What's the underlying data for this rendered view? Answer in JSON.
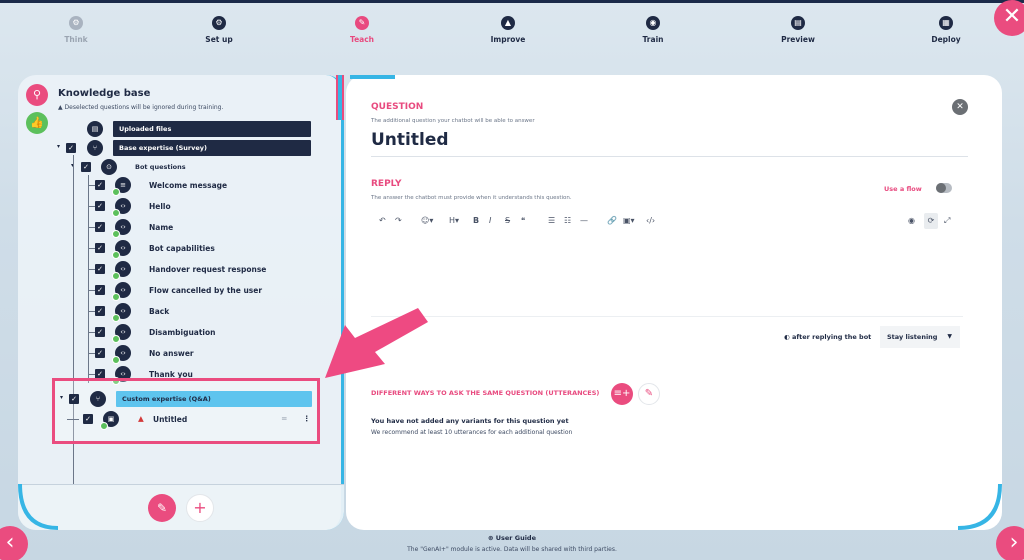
{
  "steps": [
    {
      "label": "Think",
      "icon": "gear-icon",
      "state": "dim"
    },
    {
      "label": "Set up",
      "icon": "gear-icon",
      "state": "done"
    },
    {
      "label": "Teach",
      "icon": "pencil-icon",
      "state": "active"
    },
    {
      "label": "Improve",
      "icon": "chart-icon",
      "state": "done"
    },
    {
      "label": "Train",
      "icon": "brain-icon",
      "state": "done"
    },
    {
      "label": "Preview",
      "icon": "chat-icon",
      "state": "done"
    },
    {
      "label": "Deploy",
      "icon": "rocket-icon",
      "state": "done"
    }
  ],
  "knowledge_base": {
    "title": "Knowledge base",
    "subtitle": "Deselected questions will be ignored during training.",
    "uploaded_files": "Uploaded files",
    "base_expertise": "Base expertise (Survey)",
    "bot_questions": "Bot questions",
    "items": [
      "Welcome message",
      "Hello",
      "Name",
      "Bot capabilities",
      "Handover request response",
      "Flow cancelled by the user",
      "Back",
      "Disambiguation",
      "No answer",
      "Thank you"
    ],
    "custom_expertise": "Custom expertise (Q&A)",
    "custom_item": "Untitled"
  },
  "editor": {
    "question_label": "QUESTION",
    "question_sub": "The additional question your chatbot will be able to answer",
    "question_title": "Untitled",
    "reply_label": "REPLY",
    "reply_sub": "The answer the chatbot must provide when it understands this question.",
    "use_flow": "Use a flow",
    "after_reply": "after replying the bot",
    "listen_select": "Stay listening",
    "utterances_label": "DIFFERENT WAYS TO ASK THE SAME QUESTION (UTTERANCES)",
    "empty_title": "You have not added any variants for this question yet",
    "empty_sub": "We recommend at least 10 utterances for each additional question"
  },
  "footer": {
    "guide": "User Guide",
    "note": "The \"GenAI+\" module is active. Data will be shared with third parties."
  },
  "colors": {
    "accent": "#ea4c7f",
    "navy": "#1f2a44",
    "blue": "#5ec4ee",
    "success": "#5cc05c"
  }
}
